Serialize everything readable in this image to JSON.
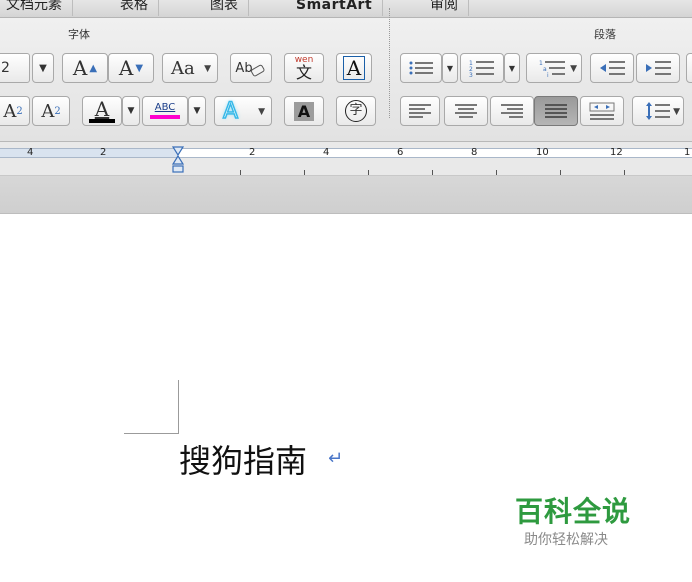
{
  "tabs": {
    "document_elements": "文档元素",
    "tables": "表格",
    "charts": "图表",
    "smartart": "SmartArt",
    "review": "审阅"
  },
  "ribbon": {
    "font_group_title": "字体",
    "paragraph_group_title": "段落",
    "font_size_value": "2",
    "grow_font": "A",
    "shrink_font": "A",
    "change_case": "Aa",
    "clear_format": "Ab",
    "phonetic_top": "wen",
    "phonetic_char": "文",
    "char_border": "A",
    "superscript_base": "A",
    "superscript_mark": "2",
    "subscript_base": "A",
    "subscript_mark": "2",
    "font_color": "A",
    "highlight": "ABC",
    "text_effect": "A",
    "char_shading": "A",
    "enclose_char": "字",
    "font_color_hex": "#000000",
    "highlight_color_hex": "#ff00cc"
  },
  "ruler": {
    "labels": [
      "4",
      "2",
      "2",
      "4",
      "6",
      "8",
      "10",
      "12",
      "1"
    ]
  },
  "document": {
    "text": "搜狗指南",
    "para_mark": "↵"
  },
  "watermark": {
    "title": "百科全说",
    "subtitle": "助你轻松解决",
    "color_hex": "#2e9a3f"
  }
}
